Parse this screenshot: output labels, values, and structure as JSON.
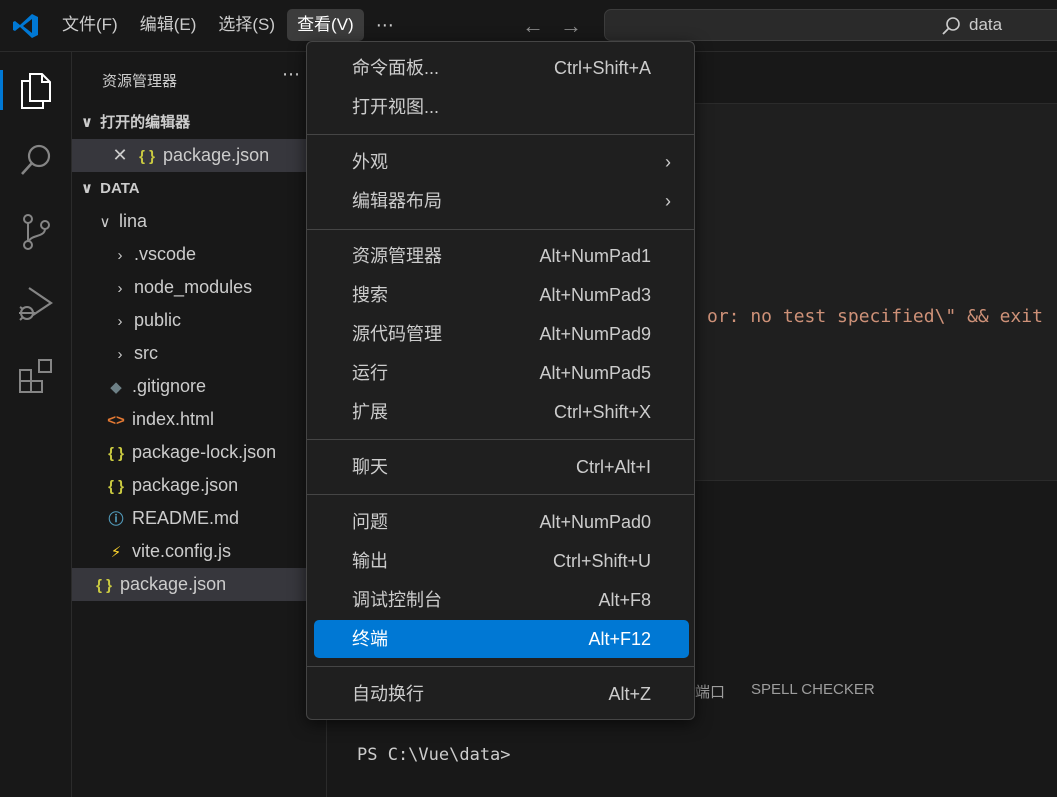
{
  "titlebar": {
    "menus": [
      "文件(F)",
      "编辑(E)",
      "选择(S)",
      "查看(V)"
    ],
    "more": "⋯",
    "back_arrow": "←",
    "forward_arrow": "→",
    "command_center_text": "data"
  },
  "activity_bar": {
    "icons": [
      "explorer-icon",
      "search-icon",
      "source-control-icon",
      "run-debug-icon",
      "extensions-icon"
    ]
  },
  "sidebar": {
    "header": "资源管理器",
    "more": "⋯",
    "open_editors_section": "打开的编辑器",
    "open_editor_file": "package.json",
    "workspace_section": "DATA",
    "folder": "lina",
    "items": [
      {
        "name": ".vscode",
        "type": "folder"
      },
      {
        "name": "node_modules",
        "type": "folder"
      },
      {
        "name": "public",
        "type": "folder"
      },
      {
        "name": "src",
        "type": "folder"
      },
      {
        "name": ".gitignore",
        "type": "git"
      },
      {
        "name": "index.html",
        "type": "html"
      },
      {
        "name": "package-lock.json",
        "type": "json"
      },
      {
        "name": "package.json",
        "type": "json"
      },
      {
        "name": "README.md",
        "type": "info"
      },
      {
        "name": "vite.config.js",
        "type": "vite"
      }
    ],
    "root_file": "package.json",
    "glyphs": {
      "json": "{ }",
      "html": "<>",
      "info": "ⓘ",
      "git": "◆",
      "vite": "⚡",
      "folder_closed": "›",
      "folder_open": "∨",
      "close": "✕"
    }
  },
  "editor": {
    "code_fragment": "or: no test specified\\\" && exit"
  },
  "panel": {
    "tab_partial": "端口",
    "tab_spell_checker": "SPELL CHECKER",
    "terminal_prompt": "PS C:\\Vue\\data>"
  },
  "view_menu": {
    "items": [
      {
        "label": "命令面板...",
        "key": "Ctrl+Shift+A"
      },
      {
        "label": "打开视图...",
        "key": ""
      },
      {
        "label": "外观",
        "key": "",
        "submenu": true
      },
      {
        "label": "编辑器布局",
        "key": "",
        "submenu": true
      },
      {
        "label": "资源管理器",
        "key": "Alt+NumPad1"
      },
      {
        "label": "搜索",
        "key": "Alt+NumPad3"
      },
      {
        "label": "源代码管理",
        "key": "Alt+NumPad9"
      },
      {
        "label": "运行",
        "key": "Alt+NumPad5"
      },
      {
        "label": "扩展",
        "key": "Ctrl+Shift+X"
      },
      {
        "label": "聊天",
        "key": "Ctrl+Alt+I"
      },
      {
        "label": "问题",
        "key": "Alt+NumPad0"
      },
      {
        "label": "输出",
        "key": "Ctrl+Shift+U"
      },
      {
        "label": "调试控制台",
        "key": "Alt+F8"
      },
      {
        "label": "终端",
        "key": "Alt+F12",
        "highlighted": true
      },
      {
        "label": "自动换行",
        "key": "Alt+Z"
      }
    ],
    "submenu_glyph": "›"
  },
  "colors": {
    "accent": "#0078d4",
    "background": "#1f1f1f",
    "sidebar": "#181818",
    "string": "#ce9178"
  }
}
